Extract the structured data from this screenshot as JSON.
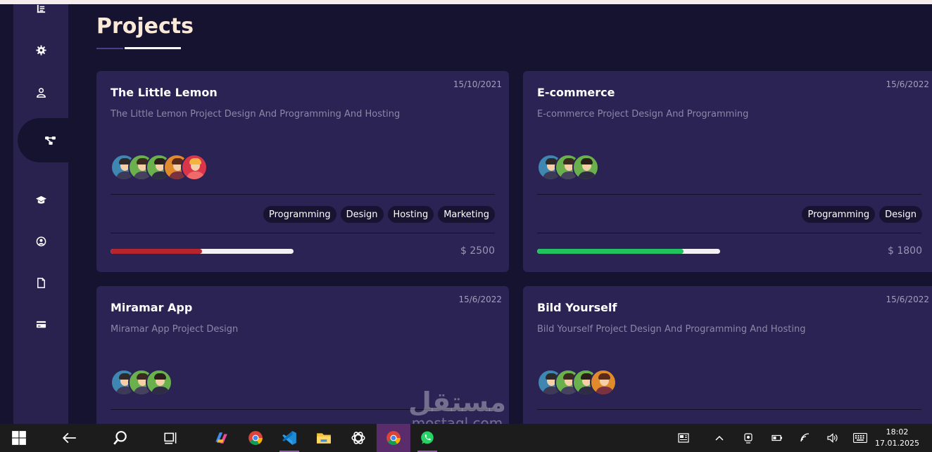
{
  "page": {
    "title": "Projects"
  },
  "sidebar": {
    "items": [
      {
        "icon": "list-icon"
      },
      {
        "icon": "gear-icon"
      },
      {
        "icon": "user-icon"
      },
      {
        "icon": "project-icon",
        "active": true
      },
      {
        "icon": "graduation-cap-icon"
      },
      {
        "icon": "user-circle-icon"
      },
      {
        "icon": "file-icon"
      },
      {
        "icon": "credit-card-icon"
      }
    ]
  },
  "projects": [
    {
      "title": "The Little Lemon",
      "date": "15/10/2021",
      "description": "The Little Lemon Project Design And Programming And Hosting",
      "tags": [
        "Programming",
        "Design",
        "Hosting",
        "Marketing"
      ],
      "progress": 0.5,
      "progress_color": "#b5252b",
      "price": "$ 2500"
    },
    {
      "title": "E-commerce",
      "date": "15/6/2022",
      "description": "E-commerce Project Design And Programming",
      "tags": [
        "Programming",
        "Design"
      ],
      "progress": 0.8,
      "progress_color": "#22c35e",
      "price": "$ 1800"
    },
    {
      "title": "Miramar App",
      "date": "15/6/2022",
      "description": "Miramar App Project Design",
      "tags": [],
      "progress": null,
      "price": ""
    },
    {
      "title": "Bild Yourself",
      "date": "15/6/2022",
      "description": "Bild Yourself Project Design And Programming And Hosting",
      "tags": [],
      "progress": null,
      "price": ""
    }
  ],
  "watermark": {
    "arabic": "مستقل",
    "latin": "mostaql.com"
  },
  "taskbar": {
    "time": "18:02",
    "date": "17.01.2025"
  },
  "colors": {
    "background": "#161330",
    "sidebar": "#29224f",
    "card": "#2a2353",
    "title": "#fbe9d8"
  }
}
